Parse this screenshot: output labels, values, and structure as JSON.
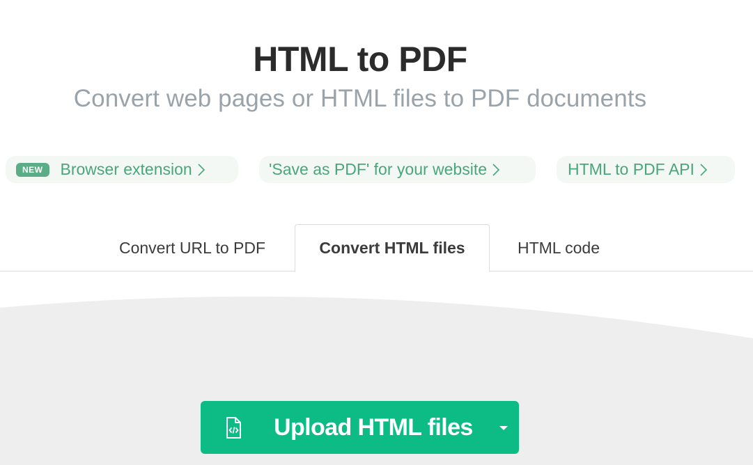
{
  "header": {
    "title": "HTML to PDF",
    "subtitle": "Convert web pages or HTML files to PDF documents"
  },
  "promo_links": [
    {
      "badge": "NEW",
      "label": "Browser extension",
      "icon": "chevron-right-icon"
    },
    {
      "label": "'Save as PDF' for your website",
      "icon": "chevron-right-icon"
    },
    {
      "label": "HTML to PDF API",
      "icon": "chevron-right-icon"
    }
  ],
  "tabs": [
    {
      "label": "Convert URL to PDF",
      "active": false
    },
    {
      "label": "Convert HTML files",
      "active": true
    },
    {
      "label": "HTML code",
      "active": false
    }
  ],
  "upload": {
    "label": "Upload HTML files",
    "icon": "html-file-icon",
    "dropdown_icon": "caret-down-icon"
  },
  "colors": {
    "accent": "#0dbb85",
    "link_green": "#4aa57a",
    "badge_green": "#5aad87",
    "chip_bg": "#f3f8f5",
    "wave_bg": "#eeeeee",
    "subtitle": "#9aa3aa"
  }
}
